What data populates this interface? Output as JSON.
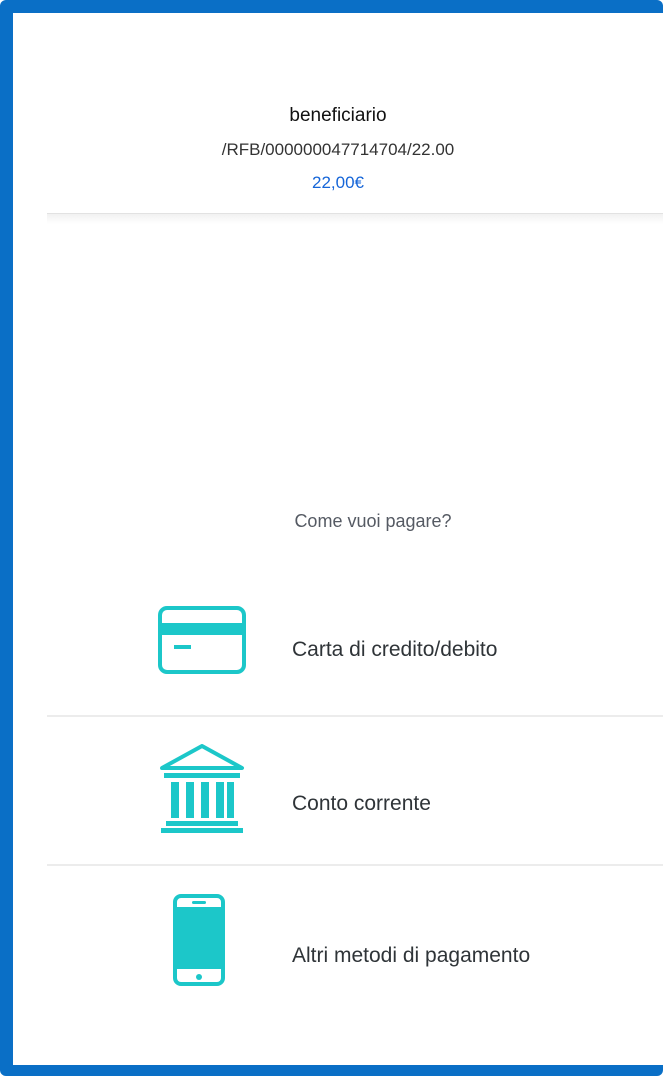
{
  "summary": {
    "beneficiary": "beneficiario",
    "reference": "/RFB/000000047714704/22.00",
    "amount": "22,00€"
  },
  "question": "Come vuoi pagare?",
  "methods": [
    {
      "label": "Carta di credito/debito",
      "icon": "credit-card-icon"
    },
    {
      "label": "Conto corrente",
      "icon": "bank-icon"
    },
    {
      "label": "Altri metodi di pagamento",
      "icon": "smartphone-icon"
    }
  ],
  "colors": {
    "frame": "#0a6fc6",
    "icon": "#1cc7c9",
    "amount": "#1565d8"
  }
}
